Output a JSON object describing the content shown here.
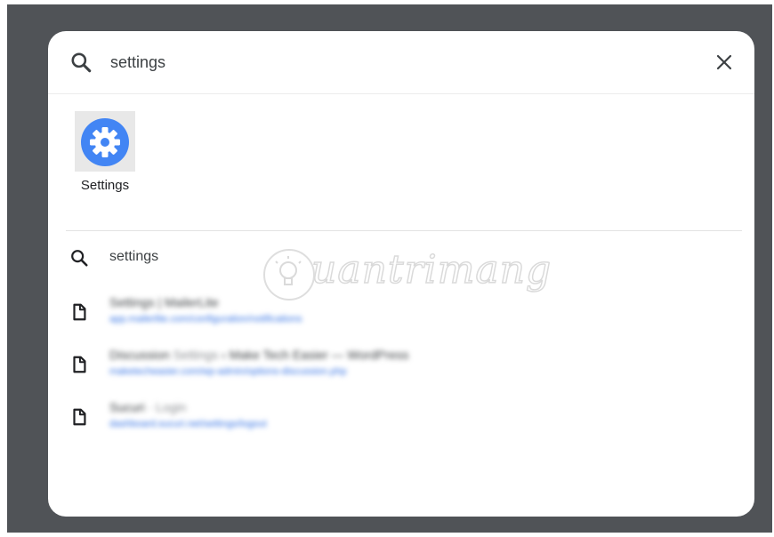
{
  "search": {
    "query": "settings"
  },
  "app_results": [
    {
      "label": "Settings",
      "icon": "gear-icon",
      "color": "#4285f4"
    }
  ],
  "query_suggestion": {
    "text": "settings",
    "icon": "search-icon"
  },
  "web_results": [
    {
      "icon": "page-icon",
      "title_main": "Settings | MailerLite",
      "title_dim": "",
      "url": "app.mailerlite.com/configuration/notifications"
    },
    {
      "icon": "page-icon",
      "title_main": "Discussion ",
      "title_dim": "Settings",
      "title_rest": " ‹ Make Tech Easier — WordPress",
      "url": "maketecheasier.com/wp-admin/options-discussion.php"
    },
    {
      "icon": "page-icon",
      "title_main": "Sucuri ",
      "title_dim": "· Login",
      "url": "dashboard.sucuri.net/settings/logout"
    }
  ],
  "watermark": {
    "text": "uantrimang"
  },
  "colors": {
    "backdrop": "#505357",
    "accent": "#4285f4",
    "link": "#2f6fe4"
  }
}
